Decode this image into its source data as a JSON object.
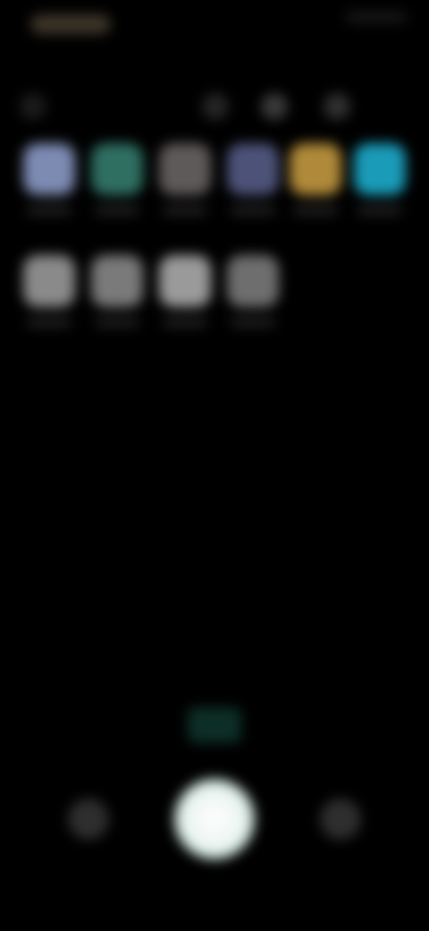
{
  "status_bar": {
    "time": "",
    "indicators": [
      "signal-icon",
      "wifi-icon",
      "battery-icon"
    ]
  },
  "top_controls": [
    {
      "icon": "flash-icon"
    },
    {
      "icon": "hdr-icon"
    },
    {
      "icon": "timer-icon"
    },
    {
      "icon": "settings-icon"
    }
  ],
  "apps_row_1": [
    {
      "label": "",
      "color": "#7d8bb3"
    },
    {
      "label": "",
      "color": "#2f6f62"
    },
    {
      "label": "",
      "color": "#5f5a5a"
    },
    {
      "label": "",
      "color": "#4d5378"
    },
    {
      "label": "",
      "color": "#b08a3a"
    },
    {
      "label": "",
      "color": "#1a9bb8"
    }
  ],
  "apps_row_2": [
    {
      "label": "",
      "color": "#8a8a8a"
    },
    {
      "label": "",
      "color": "#7a7a7a"
    },
    {
      "label": "",
      "color": "#9a9a9a"
    },
    {
      "label": "",
      "color": "#6e6e6e"
    }
  ],
  "zoom_label": "",
  "modes": [
    {
      "label": ""
    },
    {
      "label": ""
    },
    {
      "label": ""
    },
    {
      "label": ""
    },
    {
      "label": ""
    },
    {
      "label": ""
    }
  ],
  "colors": {
    "background": "#000000",
    "accent": "#1a9bb8",
    "shutter": "#ffffff"
  }
}
